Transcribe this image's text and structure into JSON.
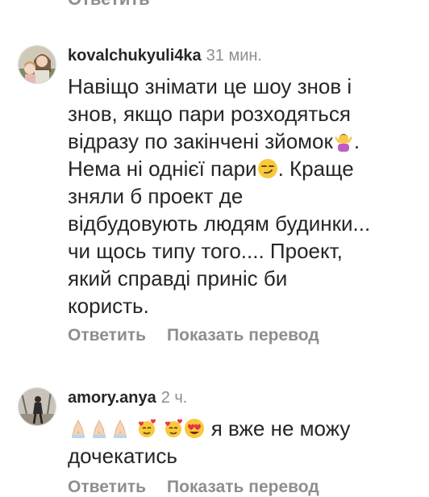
{
  "top_cut": {
    "reply_label": "Ответить"
  },
  "comments": [
    {
      "username": "kovalchukyuli4ka",
      "time": "31 мин.",
      "lines": [
        "Навіщо знімати це шоу знов і",
        "знов, якщо пари розходяться",
        "відразу по закінчені зйомок",
        "Нема ні однієї пари",
        "зняли б проект де",
        "відбудовують людям будинки...",
        "чи щось типу того.... Проект,",
        "який справді приніс би",
        "користь."
      ],
      "line3_suffix": ".",
      "line4_suffix": ". Краще",
      "emoji": [
        "person-shrugging",
        "smirking-face"
      ],
      "reply_label": "Ответить",
      "translate_label": "Показать перевод"
    },
    {
      "username": "amory.anya",
      "time": "2 ч.",
      "lines": [
        "я вже не можу",
        "дочекатись"
      ],
      "emoji": [
        "folded-hands",
        "folded-hands",
        "folded-hands",
        "smiling-face-with-hearts",
        "smiling-face-with-hearts",
        "heart-eyes-face"
      ],
      "reply_label": "Ответить",
      "translate_label": "Показать перевод"
    }
  ]
}
